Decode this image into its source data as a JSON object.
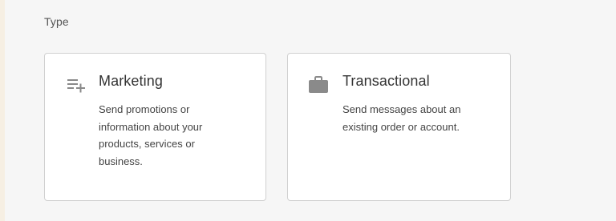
{
  "section": {
    "label": "Type"
  },
  "cards": [
    {
      "icon": "playlist-add-icon",
      "title": "Marketing",
      "description": "Send promotions or information about your products, services or business."
    },
    {
      "icon": "briefcase-icon",
      "title": "Transactional",
      "description": "Send messages about an existing order or account."
    }
  ],
  "colors": {
    "background": "#f6f6f6",
    "card_background": "#ffffff",
    "card_border": "#d0d0d0",
    "icon": "#8a8a8a",
    "text": "#333333"
  }
}
